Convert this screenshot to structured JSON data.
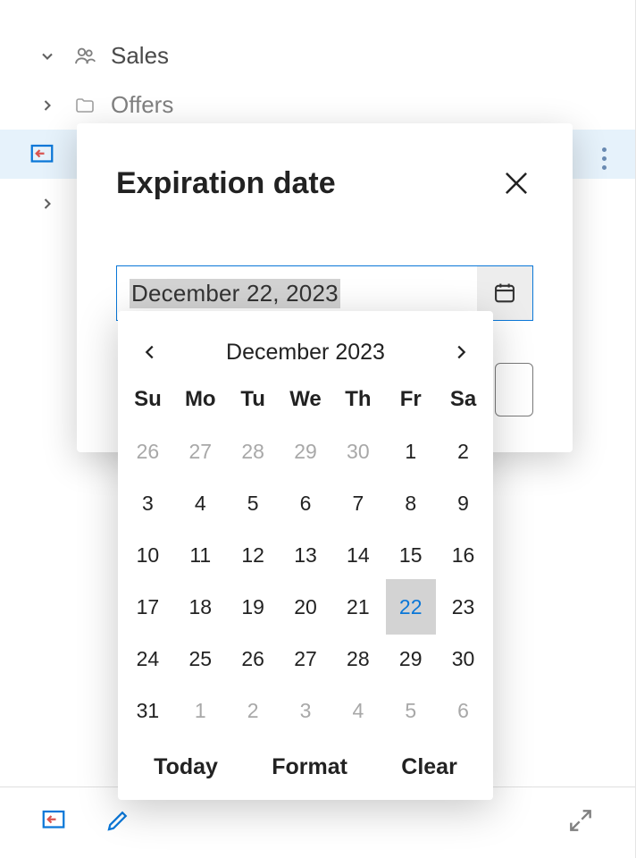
{
  "nav": {
    "items": [
      {
        "label": "Sales"
      },
      {
        "label": "Offers"
      },
      {
        "label": ""
      },
      {
        "label": ""
      }
    ]
  },
  "modal": {
    "title": "Expiration date",
    "date_value": "December 22, 2023"
  },
  "calendar": {
    "month_label": "December 2023",
    "dow": [
      "Su",
      "Mo",
      "Tu",
      "We",
      "Th",
      "Fr",
      "Sa"
    ],
    "weeks": [
      [
        {
          "n": "26",
          "outside": true
        },
        {
          "n": "27",
          "outside": true
        },
        {
          "n": "28",
          "outside": true
        },
        {
          "n": "29",
          "outside": true
        },
        {
          "n": "30",
          "outside": true
        },
        {
          "n": "1"
        },
        {
          "n": "2"
        }
      ],
      [
        {
          "n": "3"
        },
        {
          "n": "4"
        },
        {
          "n": "5"
        },
        {
          "n": "6"
        },
        {
          "n": "7"
        },
        {
          "n": "8"
        },
        {
          "n": "9"
        }
      ],
      [
        {
          "n": "10"
        },
        {
          "n": "11"
        },
        {
          "n": "12"
        },
        {
          "n": "13"
        },
        {
          "n": "14"
        },
        {
          "n": "15"
        },
        {
          "n": "16"
        }
      ],
      [
        {
          "n": "17"
        },
        {
          "n": "18"
        },
        {
          "n": "19"
        },
        {
          "n": "20"
        },
        {
          "n": "21"
        },
        {
          "n": "22",
          "selected": true
        },
        {
          "n": "23"
        }
      ],
      [
        {
          "n": "24"
        },
        {
          "n": "25"
        },
        {
          "n": "26"
        },
        {
          "n": "27"
        },
        {
          "n": "28"
        },
        {
          "n": "29"
        },
        {
          "n": "30"
        }
      ],
      [
        {
          "n": "31"
        },
        {
          "n": "1",
          "outside": true
        },
        {
          "n": "2",
          "outside": true
        },
        {
          "n": "3",
          "outside": true
        },
        {
          "n": "4",
          "outside": true
        },
        {
          "n": "5",
          "outside": true
        },
        {
          "n": "6",
          "outside": true
        }
      ]
    ],
    "actions": {
      "today": "Today",
      "format": "Format",
      "clear": "Clear"
    }
  }
}
